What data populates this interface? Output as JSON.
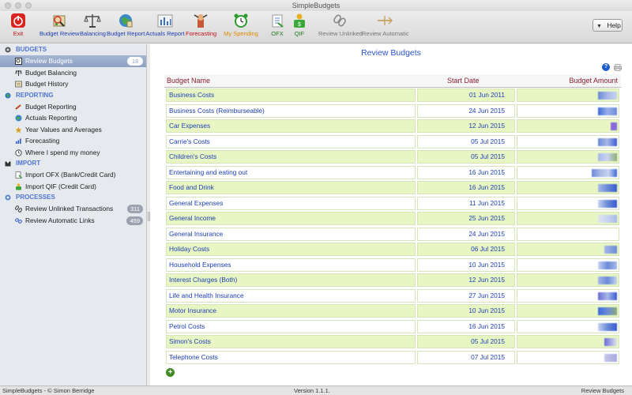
{
  "window": {
    "title": "SimpleBudgets"
  },
  "toolbar": {
    "items": [
      {
        "label": "Exit",
        "icon": "exit-icon"
      },
      {
        "label": "Budget Review",
        "icon": "budget-review-icon"
      },
      {
        "label": "Balancing",
        "icon": "scales-icon"
      },
      {
        "label": "Budget Report",
        "icon": "budget-report-icon"
      },
      {
        "label": "Actuals Report",
        "icon": "bar-chart-icon"
      },
      {
        "label": "Forecasting",
        "icon": "forecasting-icon"
      },
      {
        "label": "My Spending",
        "icon": "alarm-clock-icon"
      },
      {
        "label": "OFX",
        "icon": "ofx-import-icon"
      },
      {
        "label": "QIF",
        "icon": "qif-import-icon"
      },
      {
        "label": "Review Unlinked",
        "icon": "unlink-icon"
      },
      {
        "label": "Review Automatic",
        "icon": "auto-link-icon"
      }
    ],
    "help_label": "Help"
  },
  "sidebar": {
    "budgets_header": "BUDGETS",
    "review_budgets": {
      "label": "Review Budgets",
      "count": "18"
    },
    "budget_balancing": "Budget Balancing",
    "budget_history": "Budget History",
    "reporting_header": "REPORTING",
    "budget_reporting": "Budget Reporting",
    "actuals_reporting": "Actuals Reporting",
    "year_values": "Year Values and Averages",
    "forecasting": "Forecasting",
    "where_spend": "Where I spend my money",
    "import_header": "IMPORT",
    "import_ofx": "Import OFX (Bank/Credit Card)",
    "import_qif": "Import QIF (Credit Card)",
    "processes_header": "PROCESSES",
    "review_unlinked": {
      "label": "Review Unlinked Transactions",
      "count": "311"
    },
    "review_automatic": {
      "label": "Review Automatic Links",
      "count": "459"
    }
  },
  "main": {
    "title": "Review Budgets",
    "columns": {
      "name": "Budget Name",
      "start": "Start Date",
      "amount": "Budget Amount"
    },
    "rows": [
      {
        "name": "Business Costs",
        "start": "01 Jun 2011"
      },
      {
        "name": "Business Costs (Reimburseable)",
        "start": "24 Jun 2015"
      },
      {
        "name": "Car Expenses",
        "start": "12 Jun 2015"
      },
      {
        "name": "Carrie's Costs",
        "start": "05 Jul 2015"
      },
      {
        "name": "Children's Costs",
        "start": "05 Jul 2015"
      },
      {
        "name": "Entertaining and eating out",
        "start": "16 Jun 2015"
      },
      {
        "name": "Food and Drink",
        "start": "16 Jun 2015"
      },
      {
        "name": "General Expenses",
        "start": "11 Jun 2015"
      },
      {
        "name": "General Income",
        "start": "25 Jun 2015"
      },
      {
        "name": "General Insurance",
        "start": "24 Jun 2015"
      },
      {
        "name": "Holiday Costs",
        "start": "06 Jul 2015"
      },
      {
        "name": "Household Expenses",
        "start": "10 Jun 2015"
      },
      {
        "name": "Interest Charges (Both)",
        "start": "12 Jun 2015"
      },
      {
        "name": "Life and Health Insurance",
        "start": "27 Jun 2015"
      },
      {
        "name": "Motor Insurance",
        "start": "10 Jun 2015"
      },
      {
        "name": "Petrol Costs",
        "start": "16 Jun 2015"
      },
      {
        "name": "Simon's Costs",
        "start": "05 Jul 2015"
      },
      {
        "name": "Telephone Costs",
        "start": "07 Jul 2015"
      }
    ]
  },
  "status": {
    "left": "SimpleBudgets - © Simon Berridge",
    "center": "Version 1.1.1.",
    "right": "Review Budgets"
  },
  "colors": {
    "accent": "#2b52d0",
    "header_text": "#8a1e2c",
    "row_alt": "#e8f6c4",
    "selection": "#8ea1c2"
  }
}
